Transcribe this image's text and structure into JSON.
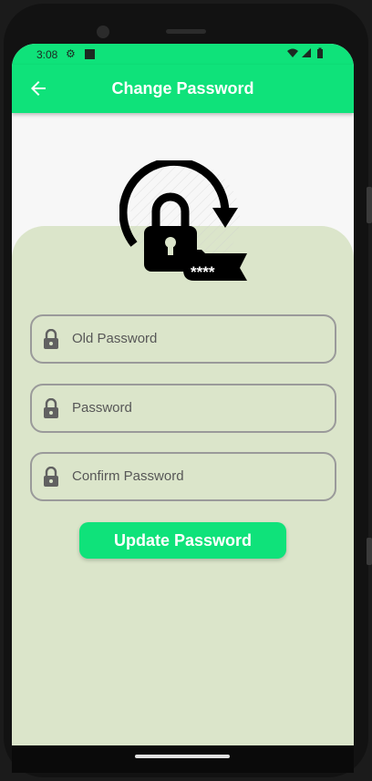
{
  "status_bar": {
    "time": "3:08"
  },
  "app_bar": {
    "title": "Change Password"
  },
  "form": {
    "old_password_placeholder": "Old Password",
    "password_placeholder": "Password",
    "confirm_password_placeholder": "Confirm Password",
    "submit_label": "Update Password"
  },
  "logo": {
    "mask_text": "****"
  },
  "colors": {
    "accent": "#0fe27a",
    "card_background": "#dbe5ca",
    "field_border": "#9a9a9a",
    "placeholder_text": "#575757"
  },
  "icons": [
    "back-arrow-icon",
    "lock-icon",
    "gear-icon",
    "wifi-icon",
    "signal-icon",
    "battery-icon"
  ]
}
